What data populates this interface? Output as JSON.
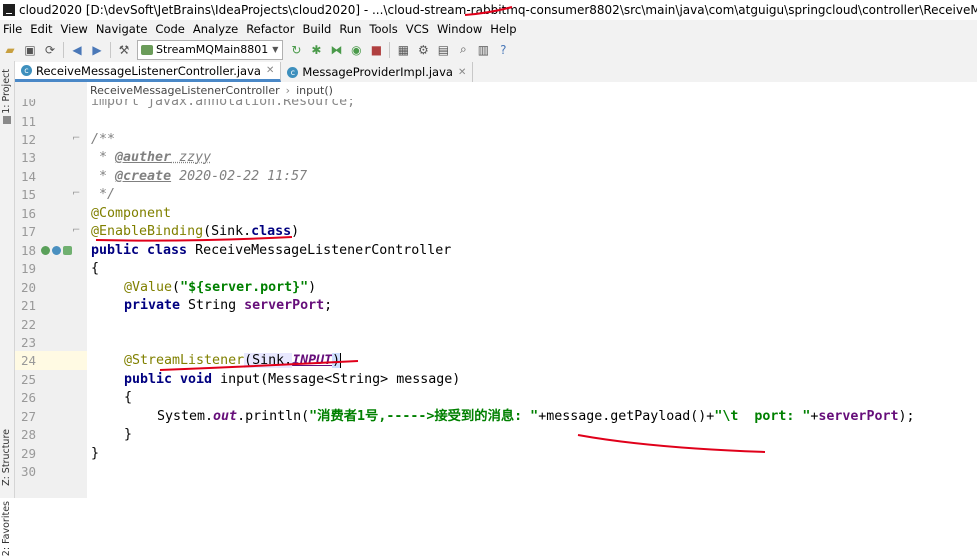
{
  "title_bar": {
    "text": "cloud2020 [D:\\devSoft\\JetBrains\\IdeaProjects\\cloud2020] - ...\\cloud-stream-rabbitmq-consumer8802\\src\\main\\java\\com\\atguigu\\springcloud\\controller\\ReceiveMessageListenerController.java [cloud"
  },
  "menu": [
    "File",
    "Edit",
    "View",
    "Navigate",
    "Code",
    "Analyze",
    "Refactor",
    "Build",
    "Run",
    "Tools",
    "VCS",
    "Window",
    "Help"
  ],
  "toolbar": {
    "run_config": "StreamMQMain8801"
  },
  "left_strip": {
    "project": "1: Project",
    "structure": "Z: Structure",
    "favorites": "2: Favorites"
  },
  "tabs": [
    {
      "label": "ReceiveMessageListenerController.java",
      "active": true
    },
    {
      "label": "MessageProviderImpl.java",
      "active": false
    }
  ],
  "breadcrumbs": [
    "ReceiveMessageListenerController",
    "input()"
  ],
  "line_numbers": [
    "10",
    "11",
    "12",
    "13",
    "14",
    "15",
    "16",
    "17",
    "18",
    "19",
    "20",
    "21",
    "22",
    "23",
    "24",
    "25",
    "26",
    "27",
    "28",
    "29",
    "30"
  ],
  "code": {
    "l10": "import javax.annotation.Resource;",
    "l12": "/**",
    "l13_star": " * ",
    "l13_tag": "@auther",
    "l13_val": " zzyy",
    "l14_star": " * ",
    "l14_tag": "@create",
    "l14_val": " 2020-02-22 11:57",
    "l15": " */",
    "l16": "@Component",
    "l17_ann": "@EnableBinding",
    "l17_a": "(Sink.",
    "l17_kw": "class",
    "l17_b": ")",
    "l18_kw": "public class ",
    "l18_name": "ReceiveMessageListenerController",
    "l19": "{",
    "l20_ann": "@Value",
    "l20_a": "(",
    "l20_str": "\"${server.port}\"",
    "l20_b": ")",
    "l21_kw": "private ",
    "l21_type": "String ",
    "l21_fld": "serverPort",
    "l21_end": ";",
    "l24_ann": "@StreamListener",
    "l24_a": "(Sink.",
    "l24_fld": "INPUT",
    "l24_b": ")",
    "l25_kw": "public void ",
    "l25_rest": "input(Message<String> message)",
    "l26": "{",
    "l27_a": "System.",
    "l27_out": "out",
    "l27_b": ".println(",
    "l27_str1": "\"消费者1号,----->接受到的消息: \"",
    "l27_c": "+message.getPayload()+",
    "l27_str2": "\"\\t  port: \"",
    "l27_d": "+",
    "l27_fld": "serverPort",
    "l27_e": ");",
    "l28": "}",
    "l29": "}"
  },
  "annotation_color": "#e0001a"
}
